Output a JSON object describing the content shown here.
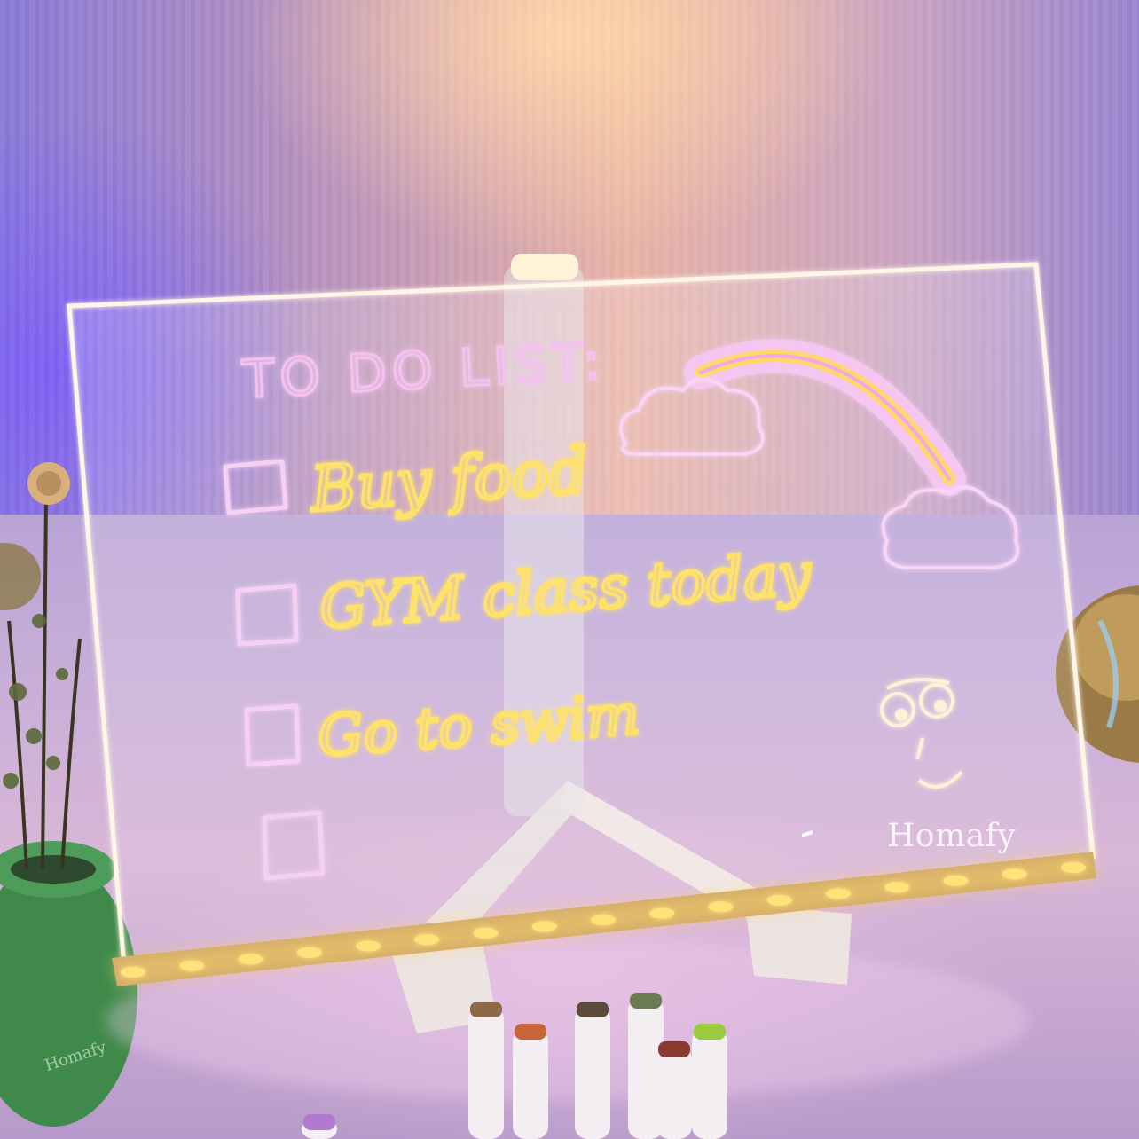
{
  "board": {
    "title": "TO DO LIST:",
    "items": [
      {
        "text": "Buy food",
        "checked": false
      },
      {
        "text": "GYM class today",
        "checked": false
      },
      {
        "text": "Go to swim",
        "checked": false
      },
      {
        "text": "",
        "checked": false
      }
    ]
  },
  "brand": "Homafy",
  "watermark": "Homafy",
  "colors": {
    "title_ink": "#f3c2ee",
    "item_ink": "#ffe26a",
    "checkbox_ink": "#f6d0f4",
    "led_glow": "#ffd46a"
  },
  "markers": {
    "cap_colors": [
      "#8a6a48",
      "#c8643a",
      "#5c4a3a",
      "#6b7a50",
      "#8a3a30",
      "#9acb3c",
      "#b07ad0"
    ]
  }
}
